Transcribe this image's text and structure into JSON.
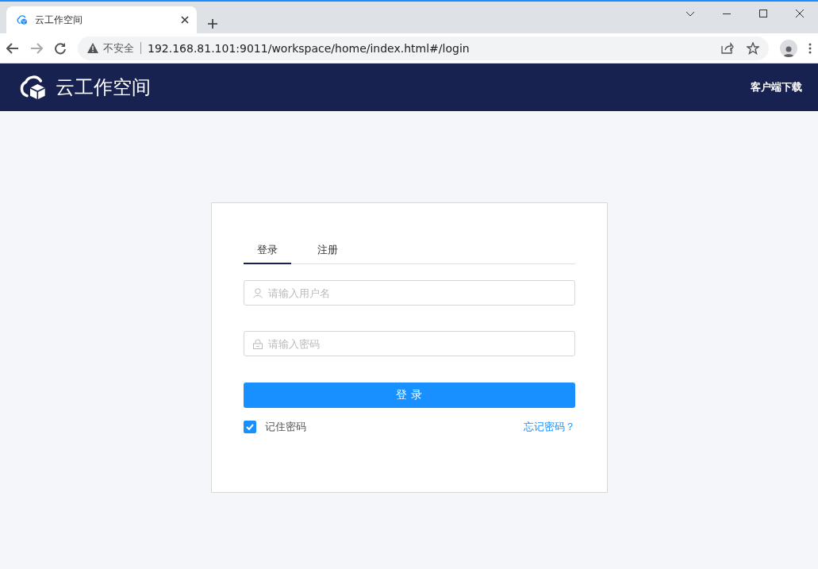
{
  "browser": {
    "tab_title": "云工作空间",
    "security_label": "不安全",
    "url": "192.168.81.101:9011/workspace/home/index.html#/login"
  },
  "header": {
    "app_name": "云工作空间",
    "download_link": "客户端下载"
  },
  "login": {
    "tabs": [
      {
        "label": "登录",
        "selected": true
      },
      {
        "label": "注册",
        "selected": false
      }
    ],
    "username": {
      "placeholder": "请输入用户名"
    },
    "password": {
      "placeholder": "请输入密码"
    },
    "submit": "登 录",
    "remember": {
      "label": "记住密码",
      "checked": true
    },
    "forgot_link": "忘记密码？"
  }
}
